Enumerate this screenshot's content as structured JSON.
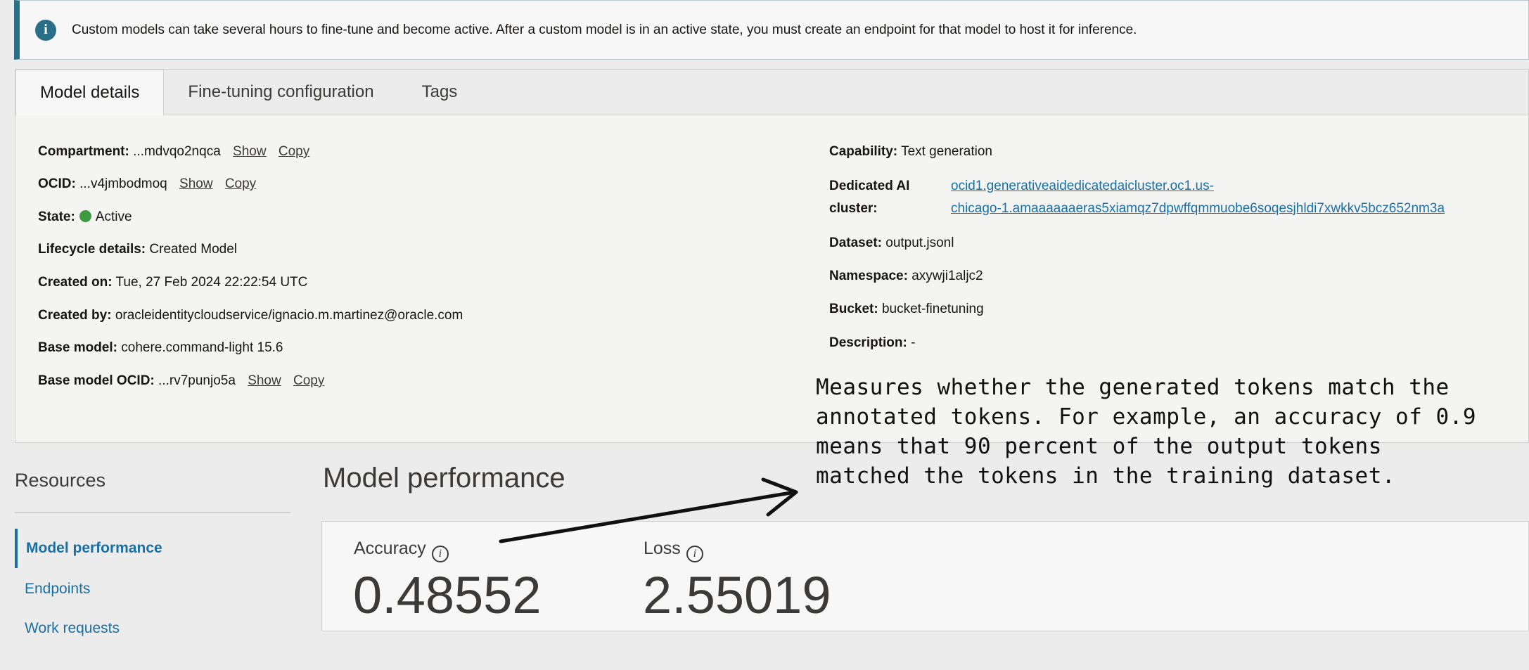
{
  "banner": {
    "icon": "info-icon",
    "text": "Custom models can take several hours to fine-tune and become active. After a custom model is in an active state, you must create an endpoint for that model to host it for inference."
  },
  "tabs": [
    {
      "label": "Model details",
      "active": true
    },
    {
      "label": "Fine-tuning configuration",
      "active": false
    },
    {
      "label": "Tags",
      "active": false
    }
  ],
  "details_left": {
    "compartment": {
      "label": "Compartment:",
      "value": "...mdvqo2nqca",
      "show": "Show",
      "copy": "Copy"
    },
    "ocid": {
      "label": "OCID:",
      "value": "...v4jmbodmoq",
      "show": "Show",
      "copy": "Copy"
    },
    "state": {
      "label": "State:",
      "value": "Active",
      "color": "#3e9a3e"
    },
    "lifecycle": {
      "label": "Lifecycle details:",
      "value": "Created Model"
    },
    "created_on": {
      "label": "Created on:",
      "value": "Tue, 27 Feb 2024 22:22:54 UTC"
    },
    "created_by": {
      "label": "Created by:",
      "value": "oracleidentitycloudservice/ignacio.m.martinez@oracle.com"
    },
    "base_model": {
      "label": "Base model:",
      "value": "cohere.command-light 15.6"
    },
    "base_model_ocid": {
      "label": "Base model OCID:",
      "value": "...rv7punjo5a",
      "show": "Show",
      "copy": "Copy"
    }
  },
  "details_right": {
    "capability": {
      "label": "Capability:",
      "value": "Text generation"
    },
    "cluster": {
      "label_line1": "Dedicated AI",
      "label_line2": "cluster:",
      "value_line1": "ocid1.generativeaidedicatedaicluster.oc1.us-",
      "value_line2": "chicago-1.amaaaaaaeras5xiamqz7dpwffqmmuobe6soqesjhldi7xwkkv5bcz652nm3a"
    },
    "dataset": {
      "label": "Dataset:",
      "value": "output.jsonl"
    },
    "namespace": {
      "label": "Namespace:",
      "value": "axywji1aljc2"
    },
    "bucket": {
      "label": "Bucket:",
      "value": "bucket-finetuning"
    },
    "description": {
      "label": "Description:",
      "value": "-"
    }
  },
  "resources": {
    "title": "Resources",
    "items": [
      {
        "label": "Model performance",
        "active": true
      },
      {
        "label": "Endpoints",
        "active": false
      },
      {
        "label": "Work requests",
        "active": false
      }
    ]
  },
  "performance": {
    "title": "Model performance",
    "accuracy": {
      "label": "Accuracy",
      "value": "0.48552"
    },
    "loss": {
      "label": "Loss",
      "value": "2.55019"
    }
  },
  "annotation": {
    "lines": [
      "Measures whether the generated tokens match the",
      "annotated tokens. For example, an accuracy of 0.9",
      "means that 90 percent of the output tokens",
      "matched the tokens in the training dataset."
    ]
  }
}
